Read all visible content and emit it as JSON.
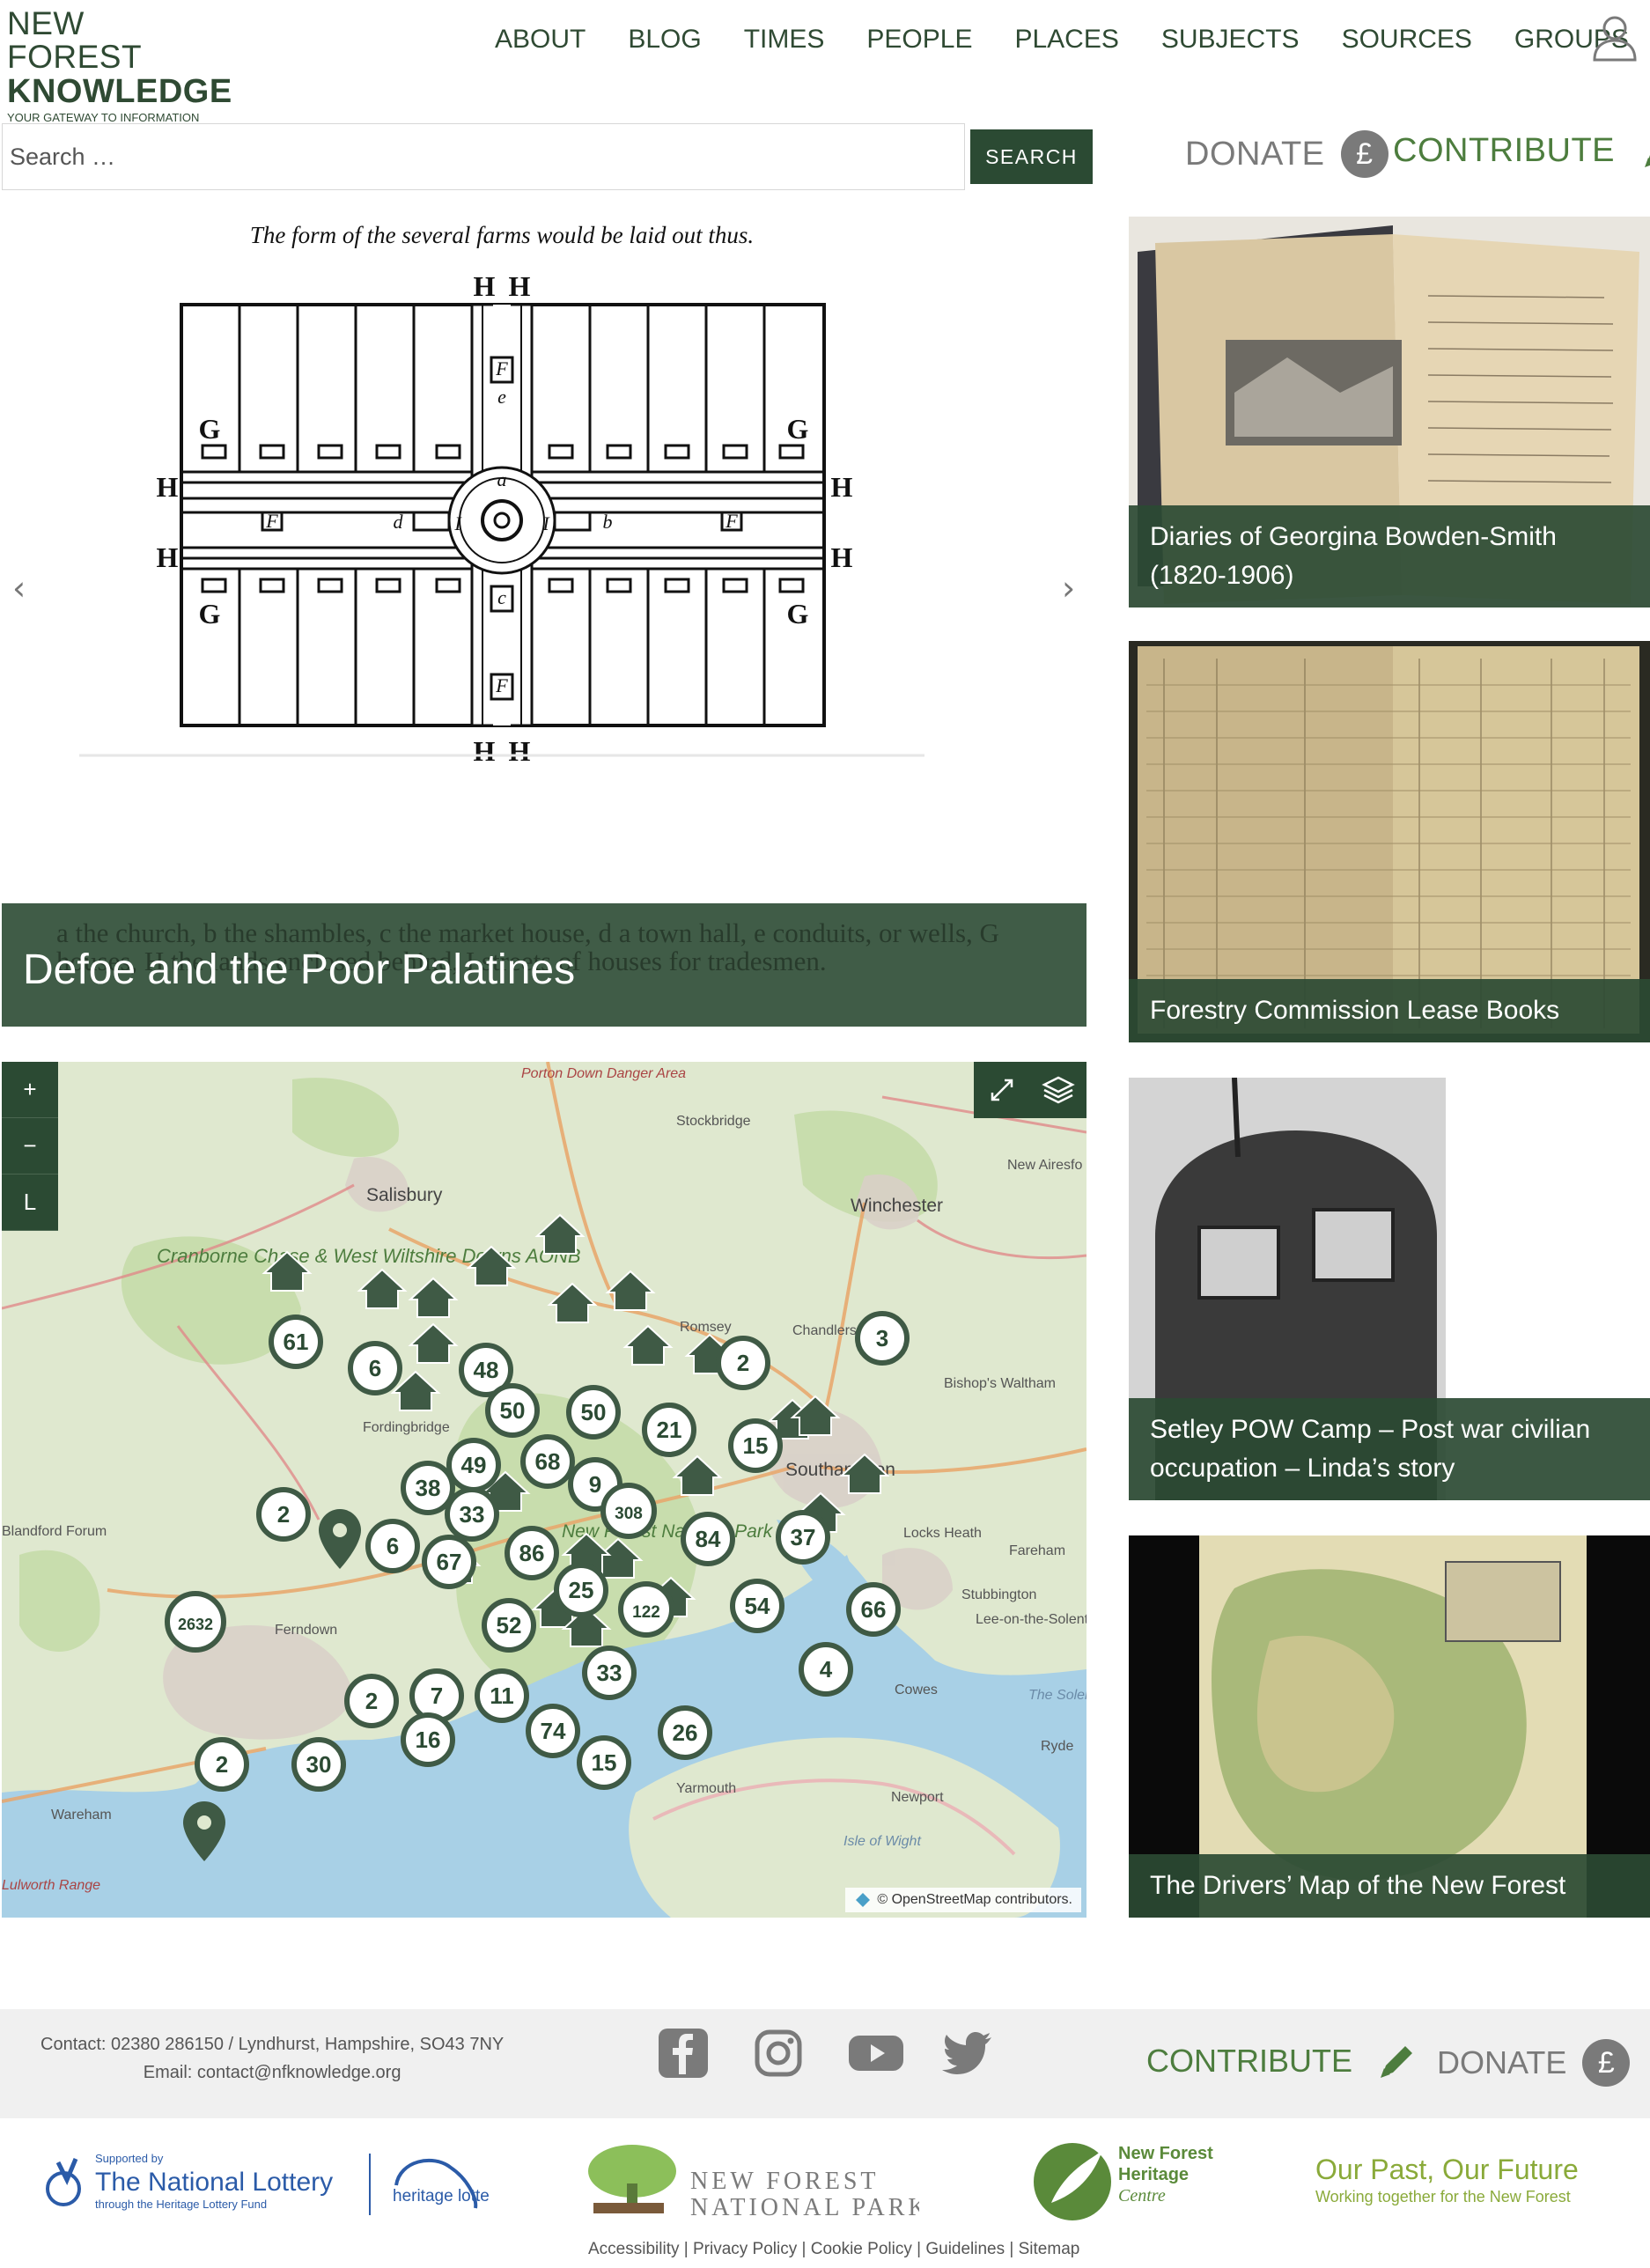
{
  "logo": {
    "line1": "NEW FOREST",
    "line2": "KNOWLEDGE",
    "tagline": "YOUR GATEWAY TO INFORMATION"
  },
  "nav": [
    "ABOUT",
    "BLOG",
    "TIMES",
    "PEOPLE",
    "PLACES",
    "SUBJECTS",
    "SOURCES",
    "GROUPS"
  ],
  "search": {
    "placeholder": "Search …",
    "button": "SEARCH"
  },
  "actions": {
    "donate": "DONATE",
    "contribute": "CONTRIBUTE",
    "currency_symbol": "£"
  },
  "slider": {
    "image_text": {
      "heading": "The form of the several farms would be laid out thus.",
      "labels": [
        "H",
        "H",
        "H",
        "H",
        "H",
        "H",
        "H",
        "H",
        "G",
        "G",
        "G",
        "G",
        "F",
        "F",
        "F",
        "F",
        "e",
        "a",
        "d",
        "I",
        "I",
        "b",
        "c"
      ],
      "legend": "a the church, b the shambles, c the market house, d a town hall, e conduits, or wells, G houses, H the lands enclosed behind, I streets of houses for tradesmen."
    },
    "caption": "Defoe and the Poor Palatines",
    "prev": "‹",
    "next": "›"
  },
  "map": {
    "controls": [
      "+",
      "−",
      "L"
    ],
    "attribution": "© OpenStreetMap contributors.",
    "attribution_osm": "OpenStreetMap",
    "place_labels": [
      {
        "name": "Porton Down Danger Area"
      },
      {
        "name": "Stockbridge"
      },
      {
        "name": "New Airesfo"
      },
      {
        "name": "Salisbury"
      },
      {
        "name": "Winchester"
      },
      {
        "name": "Cranborne Chase & West Wiltshire Downs AONB"
      },
      {
        "name": "Chandlers Ford"
      },
      {
        "name": "Bishop's Waltham"
      },
      {
        "name": "Romsey"
      },
      {
        "name": "Fordingbridge"
      },
      {
        "name": "Southampton"
      },
      {
        "name": "Blandford Forum"
      },
      {
        "name": "Locks Heath"
      },
      {
        "name": "Fareham"
      },
      {
        "name": "New Forest National Park"
      },
      {
        "name": "Ferndown"
      },
      {
        "name": "Stubbington"
      },
      {
        "name": "Lee-on-the-Solent"
      },
      {
        "name": "Cowes"
      },
      {
        "name": "The Solent"
      },
      {
        "name": "Ryde"
      },
      {
        "name": "Yarmouth"
      },
      {
        "name": "Newport"
      },
      {
        "name": "Wareham"
      },
      {
        "name": "Isle of Wight"
      },
      {
        "name": "Lulworth Range"
      }
    ],
    "clusters": [
      "61",
      "6",
      "48",
      "50",
      "2",
      "3",
      "50",
      "21",
      "15",
      "68",
      "9",
      "38",
      "49",
      "33",
      "2",
      "308",
      "6",
      "67",
      "86",
      "84",
      "37",
      "25",
      "54",
      "66",
      "2632",
      "52",
      "122",
      "4",
      "7",
      "11",
      "2",
      "74",
      "33",
      "26",
      "16",
      "30",
      "2",
      "15"
    ]
  },
  "cards": [
    {
      "title": "Diaries of Georgina Bowden-Smith (1820-1906)"
    },
    {
      "title": "Forestry Commission Lease Books"
    },
    {
      "title": "Setley POW Camp – Post war civilian occupation – Linda’s story"
    },
    {
      "title": "The Drivers’ Map of the New Forest"
    }
  ],
  "footer": {
    "contact_line1": "Contact: 02380 286150 / Lyndhurst, Hampshire, SO43 7NY",
    "contact_line2": "Email: contact@nfknowledge.org",
    "social": [
      "facebook-icon",
      "instagram-icon",
      "youtube-icon",
      "twitter-icon"
    ],
    "contribute": "CONTRIBUTE",
    "donate": "DONATE",
    "currency_symbol": "£"
  },
  "partners": {
    "lottery_supported": "Supported by",
    "lottery_name": "The National Lottery",
    "lottery_sub": "through the Heritage Lottery Fund",
    "hlf": "heritage lottery fund",
    "nfnp_line1": "NEW FOREST",
    "nfnp_line2": "NATIONAL PARK",
    "nfhc_line1": "New Forest",
    "nfhc_line2": "Heritage",
    "nfhc_line3": "Centre",
    "opof_title": "Our Past, Our Future",
    "opof_sub": "Working together for the New Forest"
  },
  "legal_links": [
    "Accessibility",
    "Privacy Policy",
    "Cookie Policy",
    "Guidelines",
    "Sitemap"
  ],
  "colors": {
    "brand_green": "#2b4a33",
    "accent_green": "#4d7d3e",
    "grey": "#7a7a7a"
  }
}
